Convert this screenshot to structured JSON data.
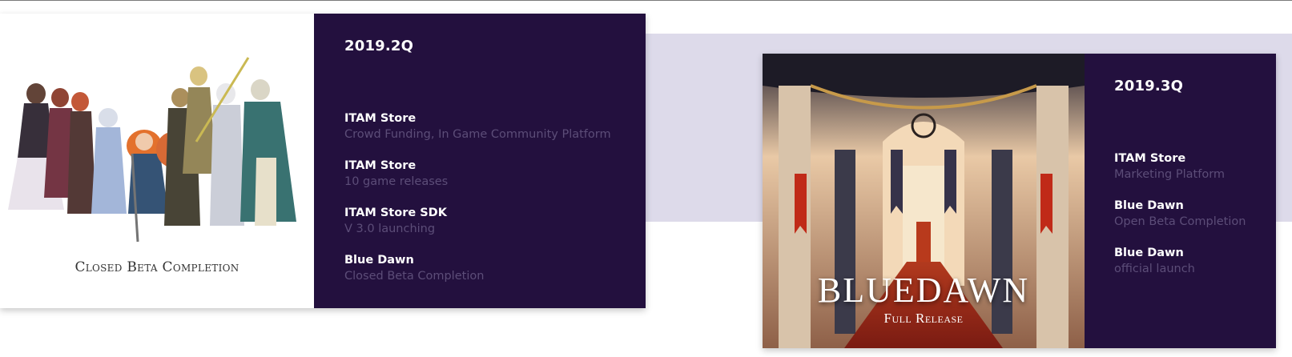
{
  "roadmap": [
    {
      "quarter": "2019.2Q",
      "art_caption": "Closed Beta Completion",
      "items": [
        {
          "title": "ITAM Store",
          "subtitle": "Crowd Funding, In Game Community Platform"
        },
        {
          "title": "ITAM Store",
          "subtitle": "10 game releases"
        },
        {
          "title": "ITAM Store SDK",
          "subtitle": "V 3.0 launching"
        },
        {
          "title": "Blue Dawn",
          "subtitle": "Closed Beta Completion"
        }
      ]
    },
    {
      "quarter": "2019.3Q",
      "art_logo": "BLUEDAWN",
      "art_caption": "Full Release",
      "items": [
        {
          "title": "ITAM Store",
          "subtitle": "Marketing Platform"
        },
        {
          "title": "Blue Dawn",
          "subtitle": "Open Beta Completion"
        },
        {
          "title": "Blue Dawn",
          "subtitle": "official launch"
        }
      ]
    }
  ],
  "colors": {
    "panel_bg": "#23103e",
    "subtitle_text": "#5c4d78",
    "band_bg": "#dddaea"
  }
}
